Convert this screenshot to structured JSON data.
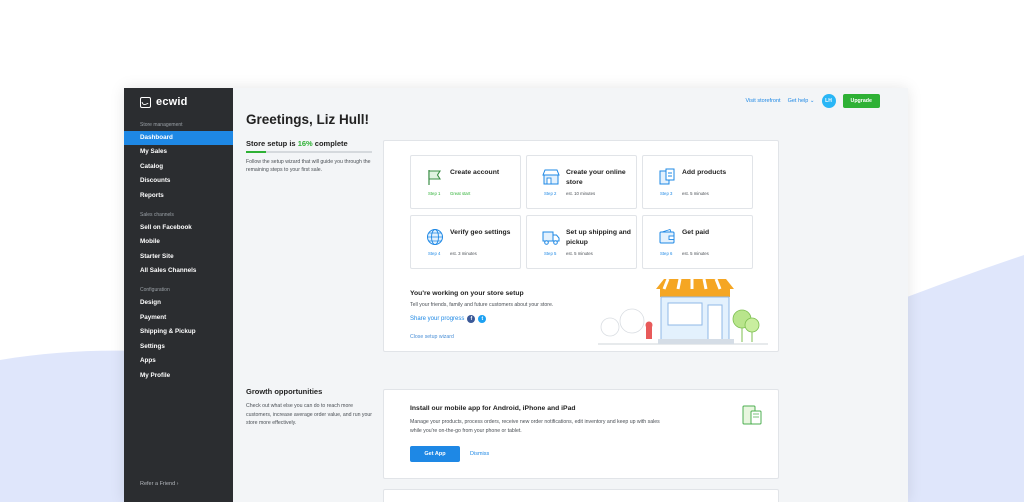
{
  "sidebar": {
    "logo": "ecwid",
    "sections": [
      {
        "title": "Store management",
        "items": [
          "Dashboard",
          "My Sales",
          "Catalog",
          "Discounts",
          "Reports"
        ]
      },
      {
        "title": "Sales channels",
        "items": [
          "Sell on Facebook",
          "Mobile",
          "Starter Site",
          "All Sales Channels"
        ]
      },
      {
        "title": "Configuration",
        "items": [
          "Design",
          "Payment",
          "Shipping & Pickup",
          "Settings",
          "Apps",
          "My Profile"
        ]
      }
    ],
    "active_item": "Dashboard",
    "refer": "Refer a Friend ›"
  },
  "topbar": {
    "visit": "Visit storefront",
    "help": "Get help ⌄",
    "avatar": "LH",
    "upgrade": "Upgrade"
  },
  "greeting": "Greetings, Liz Hull!",
  "setup": {
    "title_prefix": "Store setup is ",
    "pct": "16%",
    "title_suffix": " complete",
    "progress": 0.16,
    "desc": "Follow the setup wizard that will guide you through the remaining steps to your first sale.",
    "steps": [
      {
        "title": "Create account",
        "step": "Step 1",
        "meta": "Great start",
        "icon": "flag-icon"
      },
      {
        "title": "Create your online store",
        "step": "Step 2",
        "meta": "est. 10 minutes",
        "icon": "storefront-icon"
      },
      {
        "title": "Add products",
        "step": "Step 3",
        "meta": "est. 5 minutes",
        "icon": "products-icon"
      },
      {
        "title": "Verify geo settings",
        "step": "Step 4",
        "meta": "est. 3 minutes",
        "icon": "globe-icon"
      },
      {
        "title": "Set up shipping and pickup",
        "step": "Step 5",
        "meta": "est. 5 minutes",
        "icon": "truck-icon"
      },
      {
        "title": "Get paid",
        "step": "Step 6",
        "meta": "est. 5 minutes",
        "icon": "wallet-icon"
      }
    ],
    "working_title": "You're working on your store setup",
    "working_desc": "Tell your friends, family and future customers about your store.",
    "share": "Share your progress",
    "close": "Close setup wizard"
  },
  "growth": {
    "title": "Growth opportunities",
    "desc": "Check out what else you can do to reach more customers, increase average order value, and run your store more effectively.",
    "app_title": "Install our mobile app for Android, iPhone and iPad",
    "app_desc": "Manage your products, process orders, receive new order notifications, edit inventory and keep up with sales while you're on-the-go from your phone or tablet.",
    "get_app": "Get App",
    "dismiss": "Dismiss"
  },
  "colors": {
    "accent": "#1e88e5",
    "success": "#2eb135",
    "sidebar": "#2b2d30"
  }
}
